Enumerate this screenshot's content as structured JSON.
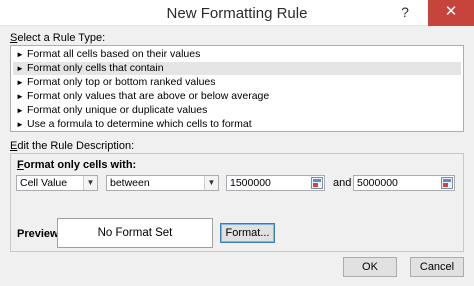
{
  "window": {
    "title": "New Formatting Rule",
    "help_glyph": "?",
    "close_glyph": "✕"
  },
  "rule_type": {
    "label_prefix": "S",
    "label_rest": "elect a Rule Type:",
    "items": [
      "Format all cells based on their values",
      "Format only cells that contain",
      "Format only top or bottom ranked values",
      "Format only values that are above or below average",
      "Format only unique or duplicate values",
      "Use a formula to determine which cells to format"
    ],
    "selected_index": 1,
    "bullet_glyph": "►"
  },
  "description": {
    "label_prefix": "E",
    "label_rest": "dit the Rule Description:",
    "heading_prefix": "F",
    "heading_rest": "ormat only cells with:",
    "condition_select": "Cell Value",
    "operator_select": "between",
    "value1": "1500000",
    "and_label": "and",
    "value2": "5000000",
    "dropdown_glyph": "▼"
  },
  "preview": {
    "label": "Preview:",
    "text": "No Format Set",
    "format_button": "Format..."
  },
  "footer": {
    "ok_label": "OK",
    "cancel_label": "Cancel"
  },
  "colors": {
    "close_button": "#c7443c",
    "selection": "#e5e5e5"
  }
}
